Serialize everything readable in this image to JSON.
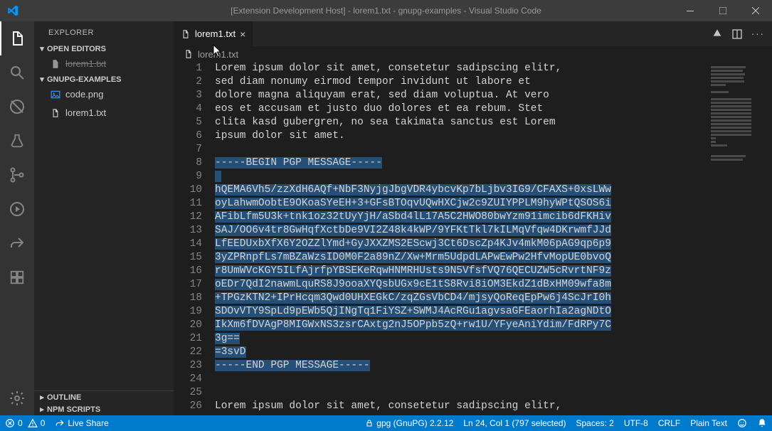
{
  "title_bar": {
    "title": "[Extension Development Host] - lorem1.txt - gnupg-examples - Visual Studio Code"
  },
  "sidebar": {
    "title": "EXPLORER",
    "open_editors_label": "OPEN EDITORS",
    "open_editor_item": "lorem1.txt",
    "project_label": "GNUPG-EXAMPLES",
    "files": [
      {
        "name": "code.png",
        "icon": "image"
      },
      {
        "name": "lorem1.txt",
        "icon": "file"
      }
    ],
    "outline_label": "OUTLINE",
    "npm_label": "NPM SCRIPTS"
  },
  "editor": {
    "tab_name": "lorem1.txt",
    "breadcrumb": "lorem1.txt",
    "lines": [
      {
        "n": 1,
        "text": "Lorem ipsum dolor sit amet, consetetur sadipscing elitr,",
        "sel": false
      },
      {
        "n": 2,
        "text": "sed diam nonumy eirmod tempor invidunt ut labore et",
        "sel": false
      },
      {
        "n": 3,
        "text": "dolore magna aliquyam erat, sed diam voluptua. At vero",
        "sel": false
      },
      {
        "n": 4,
        "text": "eos et accusam et justo duo dolores et ea rebum. Stet",
        "sel": false
      },
      {
        "n": 5,
        "text": "clita kasd gubergren, no sea takimata sanctus est Lorem",
        "sel": false
      },
      {
        "n": 6,
        "text": "ipsum dolor sit amet.",
        "sel": false
      },
      {
        "n": 7,
        "text": "",
        "sel": false
      },
      {
        "n": 8,
        "text": "-----BEGIN PGP MESSAGE-----",
        "sel": true
      },
      {
        "n": 9,
        "text": "",
        "sel": true,
        "empty_sel": true
      },
      {
        "n": 10,
        "text": "hQEMA6Vh5/zzXdH6AQf+NbF3NyjgJbgVDR4ybcvKp7bLjbv3IG9/CFAXS+0xsLWw",
        "sel": true
      },
      {
        "n": 11,
        "text": "oyLahwmOobtE9OKoaSYeEH+3+GFsBTOqvUQwHXCjw2c9ZUIYPPLM9hyWPtQSOS6i",
        "sel": true
      },
      {
        "n": 12,
        "text": "AFibLfm5U3k+tnk1oz32tUyYjH/aSbd4lL17A5C2HWO80bwYzm91imcib6dFKHiv",
        "sel": true
      },
      {
        "n": 13,
        "text": "SAJ/OO6v4tr8GwHqfXctbDe9VI2Z48k4kWP/9YFKtTkl7kILMqVfqw4DKrwmfJJd",
        "sel": true
      },
      {
        "n": 14,
        "text": "LfEEDUxbXfX6Y2OZZlYmd+GyJXXZMS2EScwj3Ct6DscZp4KJv4mkM06pAG9qp6p9",
        "sel": true
      },
      {
        "n": 15,
        "text": "3yZPRnpfLs7mBZaWzsID0M0F2a89nZ/Xw+Mrm5UdpdLAPwEwPw2HfvMopUE0bvoQ",
        "sel": true
      },
      {
        "n": 16,
        "text": "r8UmWVcKGY5ILfAjrfpYBSEKeRqwHNMRHUsts9N5VfsfVQ76QECUZW5cRvrtNF9z",
        "sel": true
      },
      {
        "n": 17,
        "text": "oEDr7QdI2nawmLquRS8J9ooaXYQsbUGx9cE1tS8Rvi8iOM3EkdZ1dBxHM09wfa8m",
        "sel": true
      },
      {
        "n": 18,
        "text": "+TPGzKTN2+IPrHcqm3Qwd0UHXEGkC/zqZGsVbCD4/mjsyQoReqEpPw6j4ScJrI0h",
        "sel": true
      },
      {
        "n": 19,
        "text": "SDOvVTY9SpLd9pEWb5QjINgTq1FiYSZ+SWMJ4AcRGu1agvsaGFEaorhIa2agNDtO",
        "sel": true
      },
      {
        "n": 20,
        "text": "IkXm6fDVAgP8MIGWxNS3zsrCAxtg2nJ5OPpb5zQ+rw1U/YFyeAniYdim/FdRPy7C",
        "sel": true
      },
      {
        "n": 21,
        "text": "3g==",
        "sel": true
      },
      {
        "n": 22,
        "text": "=3svD",
        "sel": true
      },
      {
        "n": 23,
        "text": "-----END PGP MESSAGE-----",
        "sel": true
      },
      {
        "n": 24,
        "text": "",
        "sel": false
      },
      {
        "n": 25,
        "text": "",
        "sel": false
      },
      {
        "n": 26,
        "text": "Lorem ipsum dolor sit amet, consetetur sadipscing elitr,",
        "sel": false
      }
    ]
  },
  "status": {
    "errors": "0",
    "warnings": "0",
    "live_share": "Live Share",
    "gpg": "gpg (GnuPG) 2.2.12",
    "position": "Ln 24, Col 1 (797 selected)",
    "spaces": "Spaces: 2",
    "encoding": "UTF-8",
    "eol": "CRLF",
    "language": "Plain Text"
  }
}
